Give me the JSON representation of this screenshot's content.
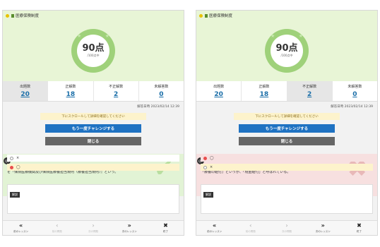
{
  "panels": [
    {
      "title": "医療保険制度",
      "score": "90点",
      "score_full": "/100点中",
      "stats": [
        {
          "label": "出題数",
          "value": "20"
        },
        {
          "label": "正解数",
          "value": "18"
        },
        {
          "label": "不正解数",
          "value": "2"
        },
        {
          "label": "未解答数",
          "value": "0"
        }
      ],
      "highlighted_stat": 0,
      "date": "解答日時 2023/02/14 12:39",
      "notice": "下にスクロールして詳細を確認してください",
      "retry": "もう一度チャレンジする",
      "close": "閉じる",
      "question": {
        "number": "Q1",
        "text": "次の問で正しい場合は◯、誤っている場合は×で答えなさい。保険による診療の範囲や基準など具体的規程を『保険医療機関及び保険医療養担当規則（療養担当規則）』という。",
        "result": "correct"
      },
      "options": [
        {
          "label": "×",
          "selected": false,
          "style": "plain"
        },
        {
          "label": "◯",
          "selected": true,
          "style": "yellow"
        }
      ],
      "explanation_tag": "解説",
      "nav": [
        {
          "icon": "«",
          "label": "前のレッスン",
          "disabled": false
        },
        {
          "icon": "‹",
          "label": "前の問題",
          "disabled": true
        },
        {
          "icon": "›",
          "label": "次の問題",
          "disabled": true
        },
        {
          "icon": "»",
          "label": "次のレッスン",
          "disabled": false
        },
        {
          "icon": "✖",
          "label": "終了",
          "disabled": false
        }
      ]
    },
    {
      "title": "医療保険制度",
      "score": "90点",
      "score_full": "/100点中",
      "stats": [
        {
          "label": "出題数",
          "value": "20"
        },
        {
          "label": "正解数",
          "value": "18"
        },
        {
          "label": "不正解数",
          "value": "2"
        },
        {
          "label": "未解答数",
          "value": "0"
        }
      ],
      "highlighted_stat": 2,
      "date": "解答日時 2023/02/14 12:39",
      "notice": "下にスクロールして詳細を確認してください",
      "retry": "もう一度チャレンジする",
      "close": "閉じる",
      "question": {
        "number": "Q7",
        "text": "次の問で正しい場合は◯、誤っている場合は×で答えなさい。療養に必要な行為又は物を給付することを『療養の給付』というが、「現金給付」と呼ばれている。",
        "result": "incorrect"
      },
      "options": [
        {
          "label": "◯",
          "selected": true,
          "style": "pink"
        },
        {
          "label": "×",
          "selected": false,
          "style": "yellow"
        }
      ],
      "explanation_tag": "解説",
      "nav": [
        {
          "icon": "«",
          "label": "前のレッスン",
          "disabled": false
        },
        {
          "icon": "‹",
          "label": "前の問題",
          "disabled": true
        },
        {
          "icon": "›",
          "label": "次の問題",
          "disabled": true
        },
        {
          "icon": "»",
          "label": "次のレッスン",
          "disabled": false
        },
        {
          "icon": "✖",
          "label": "終了",
          "disabled": false
        }
      ]
    }
  ],
  "colors": {
    "accent": "#1f72c2",
    "score_ring": "#9fd17a",
    "header_bg": "#e8f5d6"
  }
}
